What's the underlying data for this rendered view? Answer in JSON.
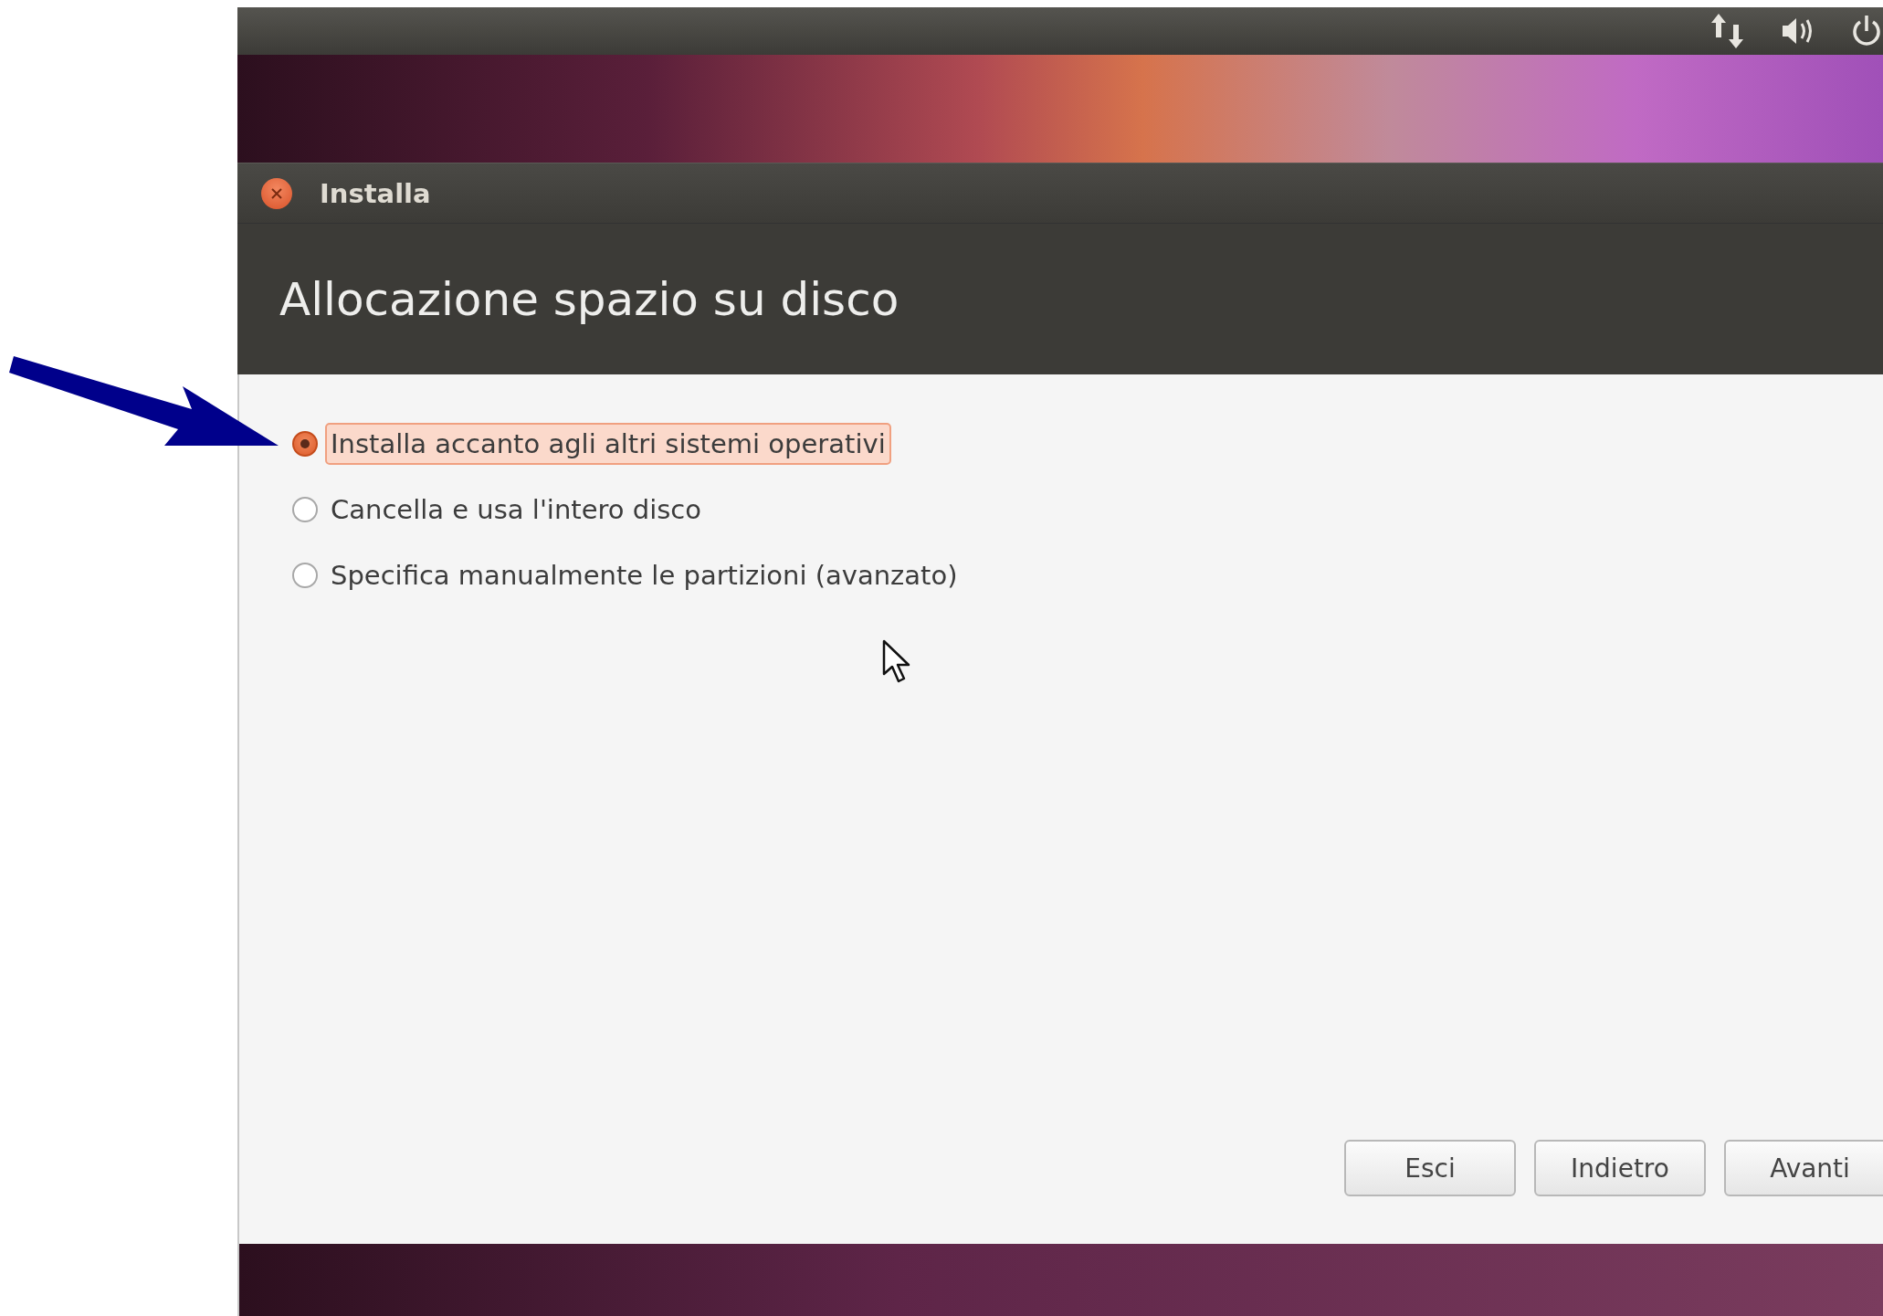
{
  "window": {
    "title": "Installa"
  },
  "heading": "Allocazione spazio su disco",
  "options": [
    {
      "label": "Installa accanto agli altri sistemi operativi",
      "selected": true
    },
    {
      "label": "Cancella e usa l'intero disco",
      "selected": false
    },
    {
      "label": "Specifica manualmente le partizioni (avanzato)",
      "selected": false
    }
  ],
  "buttons": [
    "Esci",
    "Indietro",
    "Avanti"
  ]
}
